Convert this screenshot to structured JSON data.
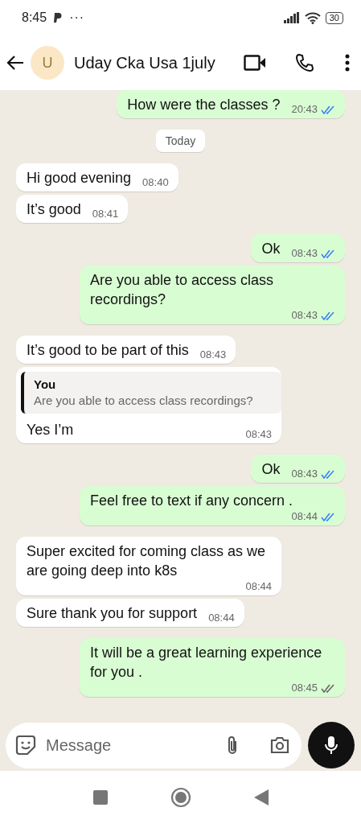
{
  "status_bar": {
    "time": "8:45",
    "more": "···",
    "battery": "30"
  },
  "header": {
    "avatar_letter": "U",
    "contact_name": "Uday Cka Usa 1july"
  },
  "messages": [
    {
      "kind": "out",
      "text": "How were the classes ?",
      "time": "20:43",
      "read": true
    },
    {
      "kind": "date",
      "text": "Today"
    },
    {
      "kind": "in",
      "text": "Hi good evening",
      "time": "08:40"
    },
    {
      "kind": "in",
      "text": "It’s good",
      "time": "08:41"
    },
    {
      "kind": "out",
      "text": "Ok",
      "time": "08:43",
      "read": true
    },
    {
      "kind": "out",
      "text": "Are you able to access class recordings?",
      "time": "08:43",
      "read": true
    },
    {
      "kind": "in",
      "text": "It’s good to be part of this",
      "time": "08:43"
    },
    {
      "kind": "in",
      "text": "Yes I’m",
      "time": "08:43",
      "reply": {
        "author": "You",
        "text": "Are you able to access class recordings?"
      }
    },
    {
      "kind": "out",
      "text": "Ok",
      "time": "08:43",
      "read": true
    },
    {
      "kind": "out",
      "text": "Feel free to text if any concern .",
      "time": "08:44",
      "read": true
    },
    {
      "kind": "in",
      "text": "Super excited for coming class as we are going deep into k8s",
      "time": "08:44"
    },
    {
      "kind": "in",
      "text": "Sure thank you for support",
      "time": "08:44"
    },
    {
      "kind": "out",
      "text": "It will be a great learning experience for you .",
      "time": "08:45",
      "read": false
    }
  ],
  "composer": {
    "placeholder": "Message"
  }
}
